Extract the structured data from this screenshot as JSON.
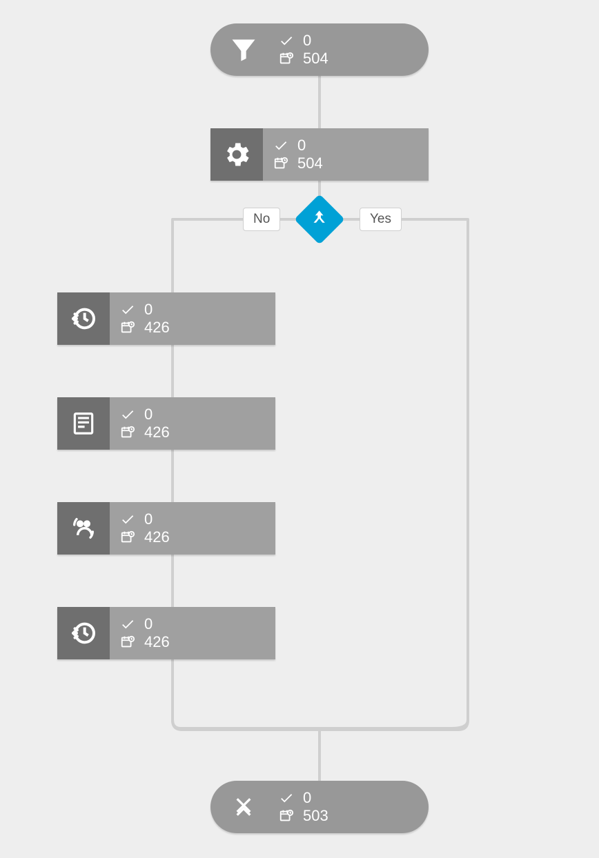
{
  "colors": {
    "bg": "#eeeeee",
    "node": "#a0a0a0",
    "node_icon_bg": "#6f6f6f",
    "pill": "#989898",
    "accent": "#00a1d6",
    "line": "#cfcfcf"
  },
  "decision": {
    "no_label": "No",
    "yes_label": "Yes"
  },
  "nodes": {
    "start": {
      "icon": "funnel-icon",
      "checked": "0",
      "history": "504"
    },
    "step_gear": {
      "icon": "gear-icon",
      "checked": "0",
      "history": "504"
    },
    "no_branch": [
      {
        "icon": "history-icon",
        "checked": "0",
        "history": "426"
      },
      {
        "icon": "form-icon",
        "checked": "0",
        "history": "426"
      },
      {
        "icon": "people-icon",
        "checked": "0",
        "history": "426"
      },
      {
        "icon": "history-icon",
        "checked": "0",
        "history": "426"
      }
    ],
    "end": {
      "icon": "close-icon",
      "checked": "0",
      "history": "503"
    }
  }
}
